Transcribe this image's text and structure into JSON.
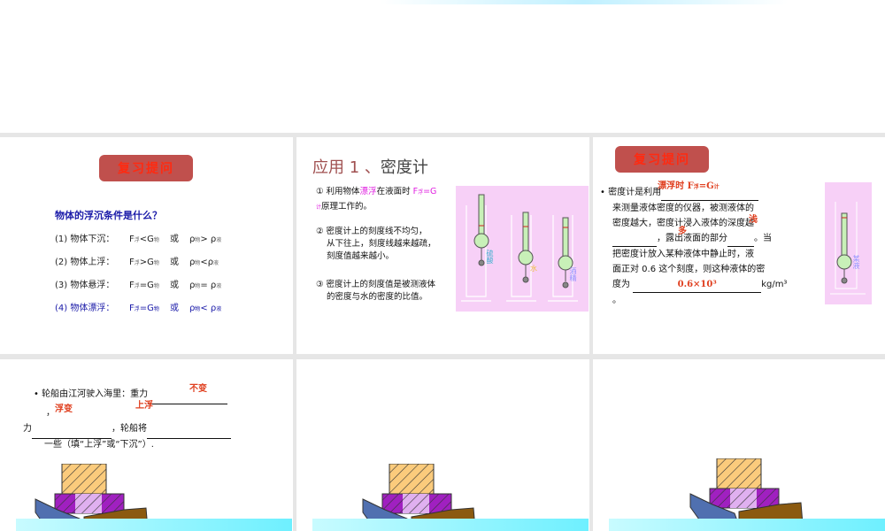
{
  "slide1": {
    "badge": "复习提问",
    "question": "物体的浮沉条件是什么？",
    "rows": [
      {
        "label": "(1) 物体下沉：",
        "f": "F",
        "fs": "浮",
        "op": "<G",
        "gs": "物",
        "or": "或",
        "rho": "ρ",
        "rs": "物",
        "rop": "> ρ",
        "ls": "液"
      },
      {
        "label": "(2) 物体上浮：",
        "f": "F",
        "fs": "浮",
        "op": ">G",
        "gs": "物",
        "or": "或",
        "rho": "ρ",
        "rs": "物",
        "rop": "<ρ",
        "ls": "液"
      },
      {
        "label": "(3) 物体悬浮：",
        "f": "F",
        "fs": "浮",
        "op": "=G",
        "gs": "物",
        "or": "或",
        "rho": "ρ",
        "rs": "物",
        "rop": "= ρ",
        "ls": "液"
      },
      {
        "label": "(4) 物体漂浮：",
        "f": "F",
        "fs": "浮",
        "op": "=G",
        "gs": "物",
        "or": "或",
        "rho": "ρ",
        "rs": "物",
        "rop": "< ρ",
        "ls": "液"
      }
    ]
  },
  "slide2": {
    "title_a": "应用 1 、",
    "title_b": "密度计",
    "p1a": "① 利用物体",
    "p1b": "漂浮",
    "p1c": "在液面时",
    "p1d": "F",
    "p1e": "浮",
    "p1f": "=G",
    "p1g": "计",
    "p1h": "原理工作的。",
    "p2": [
      "②  密度计上的刻度线不均匀，",
      "从下往上，刻度线越来越疏，",
      "刻度值越来越小。"
    ],
    "p3": [
      "③ 密度计上的刻度值是被测液体",
      "的密度与水的密度的比值。"
    ],
    "liquids": [
      "硫酸",
      "水",
      "酒精"
    ]
  },
  "slide3": {
    "badge": "复习提问",
    "bullet": "•",
    "l1": "密度计是利用",
    "a1": "漂浮时 F",
    "a1s": "浮",
    "a1b": "=G",
    "a1c": "计",
    "l2": "来测量液体密度的仪器，被测液体的",
    "l3": "密度越大，密度计浸入液体的深度越",
    "a2": "浅",
    "l4": "，露出液面的部分",
    "a3": "多",
    "l4b": "。当",
    "l5": "把密度计放入某种液体中静止时，液",
    "l6": "面正对 0.6 这个刻度，则这种液体的密",
    "l7": "度为",
    "a4": "0.6×10³",
    "unit": "kg/m³",
    "l8": "。",
    "liquid": "某液"
  },
  "slide4": {
    "bullet": "•",
    "l1": "轮船由江河驶入海里：重力",
    "a1": "不变",
    "l2": "，",
    "a2": "浮变",
    "a3": "上浮",
    "l3a": "力",
    "l3b": "，轮船将",
    "l4": "一些（填“上浮”或“下沉”）."
  }
}
